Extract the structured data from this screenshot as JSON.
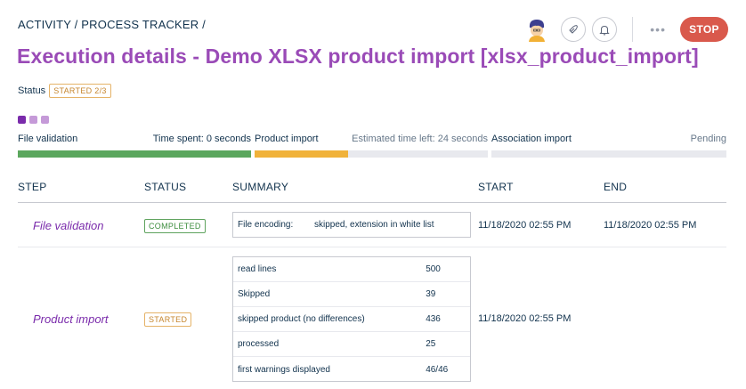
{
  "breadcrumb": "ACTIVITY / PROCESS TRACKER /",
  "header": {
    "title": "Execution details - Demo XLSX product import [xlsx_product_import]",
    "stop_label": "STOP",
    "more_label": "•••"
  },
  "status": {
    "label": "Status",
    "value": "STARTED 2/3"
  },
  "steps_progress": [
    {
      "name": "File validation",
      "info": "Time spent: 0 seconds",
      "state": "completed",
      "fill_fraction": 1.0,
      "color": "#5ba75e"
    },
    {
      "name": "Product import",
      "info": "Estimated time left: 24 seconds",
      "state": "started",
      "fill_fraction": 0.4,
      "color": "#f0b23a"
    },
    {
      "name": "Association import",
      "info": "Pending",
      "state": "pending",
      "fill_fraction": 0.0,
      "color": "#e8e9ee"
    }
  ],
  "step_dot_colors": [
    "#7a2bab",
    "#c59ad8",
    "#c59ad8"
  ],
  "table": {
    "headers": {
      "step": "STEP",
      "status": "STATUS",
      "summary": "SUMMARY",
      "start": "START",
      "end": "END"
    },
    "rows": [
      {
        "step": "File validation",
        "status": "COMPLETED",
        "summary": [
          {
            "key": "File encoding:",
            "value": "skipped, extension in white list"
          }
        ],
        "start": "11/18/2020 02:55 PM",
        "end": "11/18/2020 02:55 PM"
      },
      {
        "step": "Product import",
        "status": "STARTED",
        "summary": [
          {
            "key": "read lines",
            "value": "500"
          },
          {
            "key": "Skipped",
            "value": "39"
          },
          {
            "key": "skipped product (no differences)",
            "value": "436"
          },
          {
            "key": "processed",
            "value": "25"
          },
          {
            "key": "first warnings displayed",
            "value": "46/46"
          }
        ],
        "start": "11/18/2020 02:55 PM",
        "end": ""
      }
    ]
  },
  "colors": {
    "title": "#9a4bb7",
    "stop": "#d9594c",
    "completed": "#5ba75e",
    "started": "#f0b23a",
    "step_name": "#7a2bab"
  }
}
